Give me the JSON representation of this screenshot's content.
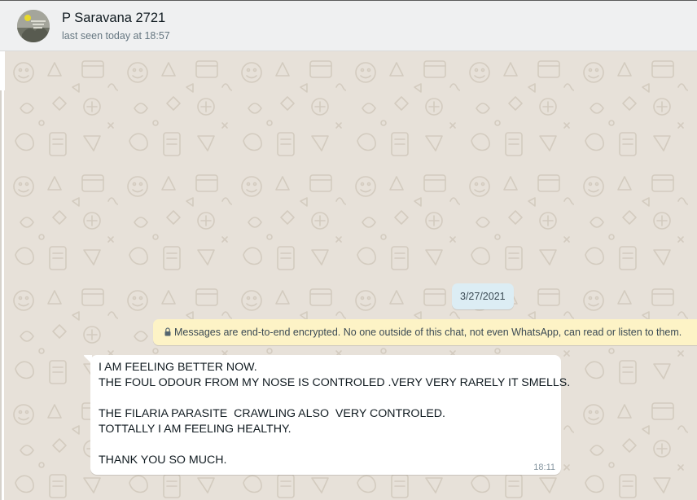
{
  "header": {
    "contact_name": "P Saravana 2721",
    "last_seen": "last seen today at 18:57",
    "avatar_icon": "contact-photo"
  },
  "chat": {
    "date_label": "3/27/2021",
    "encryption_notice": "Messages are end-to-end encrypted. No one outside of this chat, not even WhatsApp, can read or listen to them.",
    "lock_icon": "lock-icon",
    "messages": [
      {
        "direction": "incoming",
        "lines": [
          "I AM FEELING BETTER NOW.",
          "THE FOUL ODOUR FROM MY NOSE IS CONTROLED .VERY VERY RARELY IT SMELLS.",
          "",
          "THE FILARIA PARASITE  CRAWLING ALSO  VERY CONTROLED.",
          "TOTTALLY I AM FEELING HEALTHY.",
          "",
          "THANK YOU SO MUCH."
        ],
        "time": "18:11"
      }
    ]
  },
  "colors": {
    "header_bg": "#eff0f1",
    "chat_bg": "#e7e1d9",
    "date_chip_bg": "#dcedf4",
    "encryption_bg": "#fdf3c6",
    "bubble_bg": "#ffffff"
  }
}
